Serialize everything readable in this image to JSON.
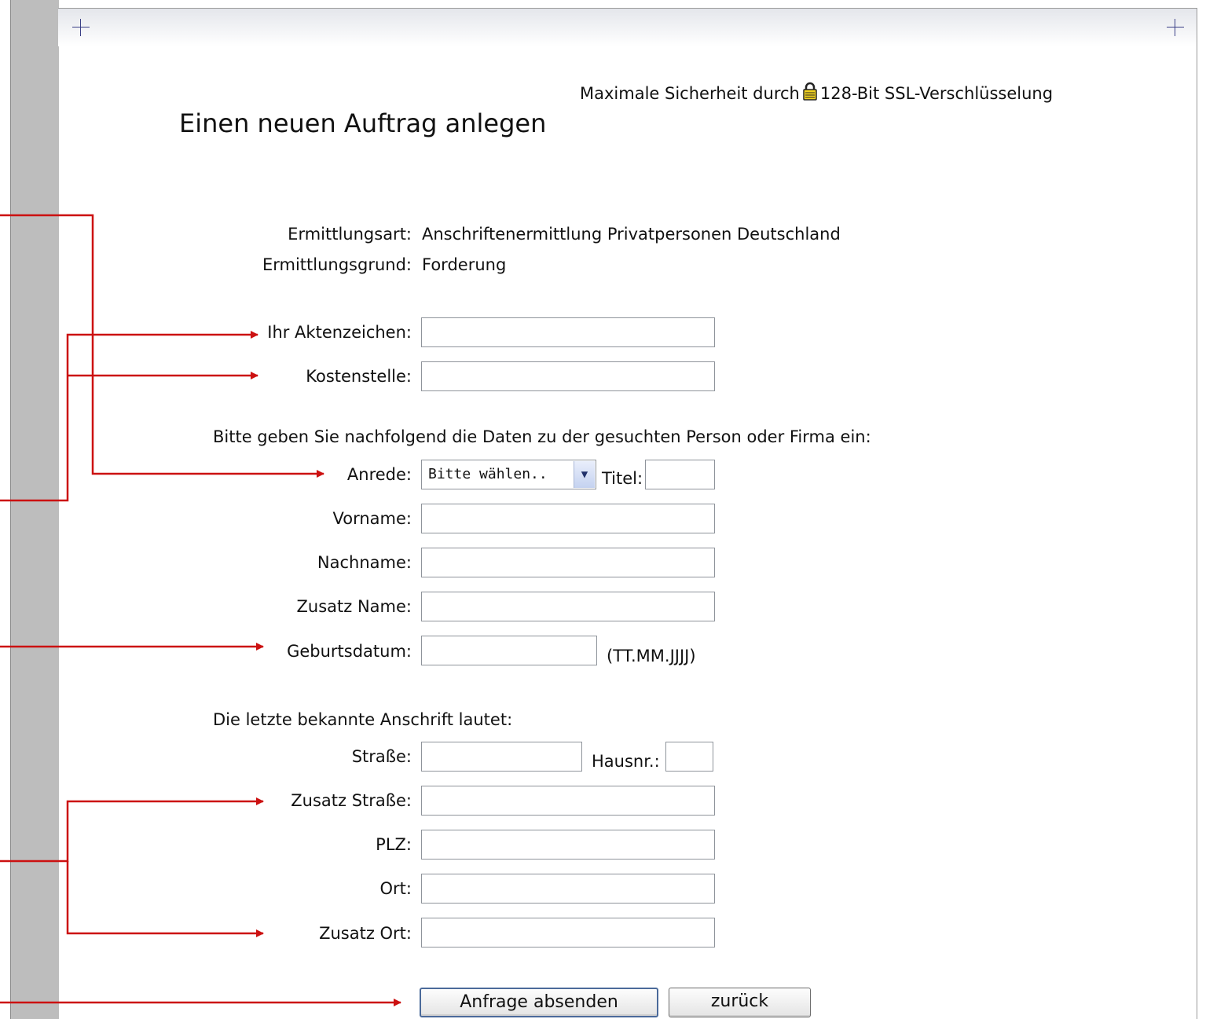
{
  "security_note": "Maximale Sicherheit durch",
  "security_note_suffix": "128-Bit SSL-Verschlüsselung",
  "page_title": "Einen neuen Auftrag anlegen",
  "summary": {
    "type_label": "Ermittlungsart:",
    "type_value": "Anschriftenermittlung Privatpersonen Deutschland",
    "reason_label": "Ermittlungsgrund:",
    "reason_value": "Forderung"
  },
  "reference": {
    "file_ref_label": "Ihr Aktenzeichen:",
    "file_ref_value": "",
    "cost_center_label": "Kostenstelle:",
    "cost_center_value": ""
  },
  "person_intro": "Bitte geben Sie nachfolgend die Daten zu der gesuchten Person oder Firma ein:",
  "person": {
    "salutation_label": "Anrede:",
    "salutation_selected": "Bitte wählen..",
    "title_label": "Titel:",
    "first_name_label": "Vorname:",
    "last_name_label": "Nachname:",
    "name_suffix_label": "Zusatz Name:",
    "birthdate_label": "Geburtsdatum:",
    "birthdate_hint": "(TT.MM.JJJJ)"
  },
  "address_intro": "Die letzte bekannte Anschrift lautet:",
  "address": {
    "street_label": "Straße:",
    "house_no_label": "Hausnr.:",
    "street_suffix_label": "Zusatz Straße:",
    "zip_label": "PLZ:",
    "city_label": "Ort:",
    "city_suffix_label": "Zusatz Ort:"
  },
  "actions": {
    "submit_label": "Anfrage absenden",
    "back_label": "zurück"
  },
  "colors": {
    "annotation_red": "#cc1111",
    "side_bar_gray": "#bdbdbd"
  }
}
